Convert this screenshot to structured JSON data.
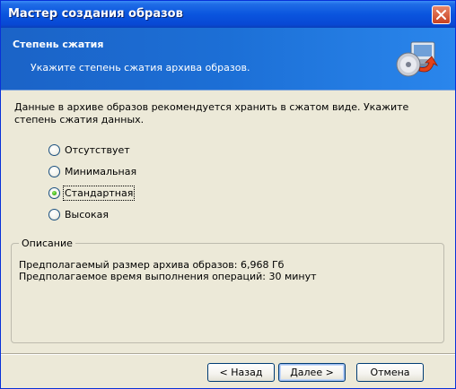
{
  "window": {
    "title": "Мастер создания образов"
  },
  "header": {
    "title": "Степень сжатия",
    "subtitle": "Укажите степень сжатия архива образов."
  },
  "instruction": "Данные в архиве образов рекомендуется хранить в сжатом виде. Укажите степень сжатия данных.",
  "compression": {
    "options": [
      {
        "label": "Отсутствует",
        "checked": false
      },
      {
        "label": "Минимальная",
        "checked": false
      },
      {
        "label": "Стандартная",
        "checked": true
      },
      {
        "label": "Высокая",
        "checked": false
      }
    ],
    "selected": "Стандартная"
  },
  "description": {
    "legend": "Описание",
    "size_line": "Предполагаемый размер архива образов: 6,968 Гб",
    "time_line": "Предполагаемое время выполнения операций: 30 минут"
  },
  "buttons": {
    "back": "< Назад",
    "next": "Далее >",
    "cancel": "Отмена"
  },
  "colors": {
    "titlebar": "#0a55de",
    "header_bg": "#1c6fd6",
    "dialog_bg": "#ece9d8",
    "radio_checked": "#3fb41b"
  }
}
